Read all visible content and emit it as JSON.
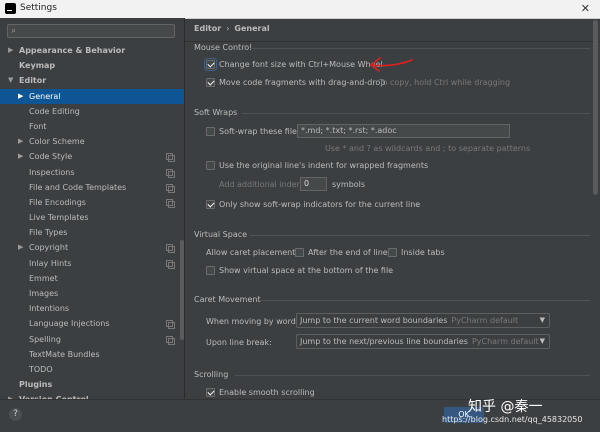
{
  "window": {
    "title": "Settings"
  },
  "search": {
    "value": ""
  },
  "sidebar": {
    "items": [
      {
        "label": "Appearance & Behavior",
        "level": 0,
        "arrow": "▶",
        "bold": true
      },
      {
        "label": "Keymap",
        "level": 0,
        "arrow": "",
        "bold": true
      },
      {
        "label": "Editor",
        "level": 0,
        "arrow": "▼",
        "bold": true
      },
      {
        "label": "General",
        "level": 1,
        "arrow": "▶",
        "selected": true
      },
      {
        "label": "Code Editing",
        "level": 1,
        "arrow": ""
      },
      {
        "label": "Font",
        "level": 1,
        "arrow": ""
      },
      {
        "label": "Color Scheme",
        "level": 1,
        "arrow": "▶"
      },
      {
        "label": "Code Style",
        "level": 1,
        "arrow": "▶",
        "copy": true
      },
      {
        "label": "Inspections",
        "level": 1,
        "arrow": "",
        "copy": true
      },
      {
        "label": "File and Code Templates",
        "level": 1,
        "arrow": "",
        "copy": true
      },
      {
        "label": "File Encodings",
        "level": 1,
        "arrow": "",
        "copy": true
      },
      {
        "label": "Live Templates",
        "level": 1,
        "arrow": ""
      },
      {
        "label": "File Types",
        "level": 1,
        "arrow": ""
      },
      {
        "label": "Copyright",
        "level": 1,
        "arrow": "▶",
        "copy": true
      },
      {
        "label": "Inlay Hints",
        "level": 1,
        "arrow": "",
        "copy": true
      },
      {
        "label": "Emmet",
        "level": 1,
        "arrow": ""
      },
      {
        "label": "Images",
        "level": 1,
        "arrow": ""
      },
      {
        "label": "Intentions",
        "level": 1,
        "arrow": ""
      },
      {
        "label": "Language Injections",
        "level": 1,
        "arrow": "",
        "copy": true
      },
      {
        "label": "Spelling",
        "level": 1,
        "arrow": "",
        "copy": true
      },
      {
        "label": "TextMate Bundles",
        "level": 1,
        "arrow": ""
      },
      {
        "label": "TODO",
        "level": 1,
        "arrow": ""
      },
      {
        "label": "Plugins",
        "level": 0,
        "arrow": "",
        "bold": true
      },
      {
        "label": "Version Control",
        "level": 0,
        "arrow": "▶",
        "bold": true
      }
    ]
  },
  "breadcrumb": {
    "parent": "Editor",
    "separator": "›",
    "current": "General"
  },
  "mouse_control": {
    "title": "Mouse Control",
    "change_font_size": "Change font size with Ctrl+Mouse Wheel",
    "move_fragments": "Move code fragments with drag-and-drop",
    "move_hint": "To copy, hold Ctrl while dragging"
  },
  "soft_wraps": {
    "title": "Soft Wraps",
    "soft_wrap_files_label": "Soft-wrap these files:",
    "soft_wrap_files_value": "*.md; *.txt; *.rst; *.adoc",
    "wildcard_hint": "Use * and ? as wildcards and ; to separate patterns",
    "use_original_indent": "Use the original line's indent for wrapped fragments",
    "add_indent_label": "Add additional indent:",
    "add_indent_value": "0",
    "add_indent_unit": "symbols",
    "only_show_indicators": "Only show soft-wrap indicators for the current line"
  },
  "virtual_space": {
    "title": "Virtual Space",
    "allow_caret": "Allow caret placement:",
    "after_end_of_line": "After the end of line",
    "inside_tabs": "Inside tabs",
    "show_virtual_space": "Show virtual space at the bottom of the file"
  },
  "caret_movement": {
    "title": "Caret Movement",
    "moving_by_words_label": "When moving by words:",
    "moving_by_words_value": "Jump to the current word boundaries",
    "moving_by_words_hint": "PyCharm default",
    "line_break_label": "Upon line break:",
    "line_break_value": "Jump to the next/previous line boundaries",
    "line_break_hint": "PyCharm default"
  },
  "scrolling": {
    "title": "Scrolling",
    "enable_smooth": "Enable smooth scrolling"
  },
  "footer": {
    "help": "?",
    "ok": "OK",
    "watermark": "知乎 @秦一",
    "url": "https://blog.csdn.net/qq_45832050"
  },
  "colors": {
    "selection": "#0d5594",
    "annotation": "#e02020"
  }
}
